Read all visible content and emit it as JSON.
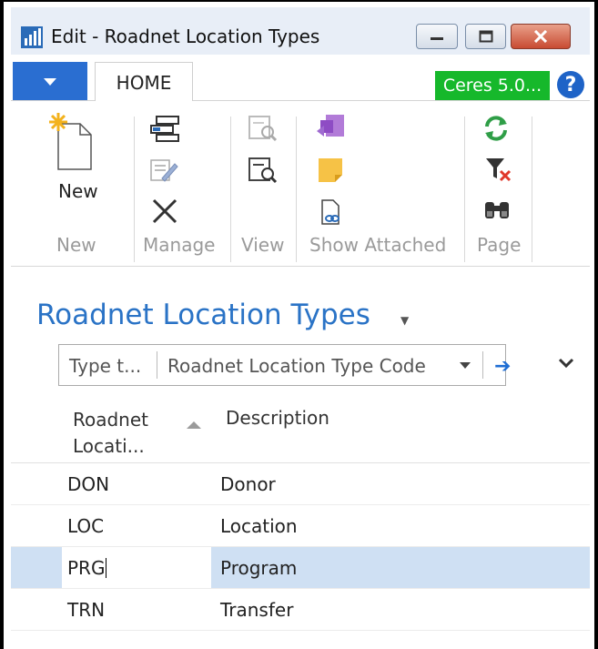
{
  "window": {
    "title": "Edit - Roadnet Location Types"
  },
  "ribbon": {
    "tab_home": "HOME",
    "company": "Ceres 5.0...",
    "help": "?",
    "new_button": "New",
    "groups": {
      "new": "New",
      "manage": "Manage",
      "view": "View",
      "show_attached": "Show Attached",
      "page": "Page"
    }
  },
  "page": {
    "title": "Roadnet Location Types"
  },
  "filter": {
    "input_placeholder": "Type t...",
    "field": "Roadnet Location Type Code"
  },
  "table": {
    "columns": [
      "Roadnet Locati...",
      "Description"
    ],
    "column1_line1": "Roadnet",
    "column1_line2": "Locati...",
    "rows": [
      {
        "code": "DON",
        "description": "Donor"
      },
      {
        "code": "LOC",
        "description": "Location"
      },
      {
        "code": "PRG",
        "description": "Program"
      },
      {
        "code": "TRN",
        "description": "Transfer"
      }
    ],
    "selected_row": 2
  },
  "colors": {
    "accent": "#2a73c6",
    "ceres_badge": "#16b82b",
    "selection": "#cfe0f3",
    "menu_blue": "#2a6ed1"
  }
}
